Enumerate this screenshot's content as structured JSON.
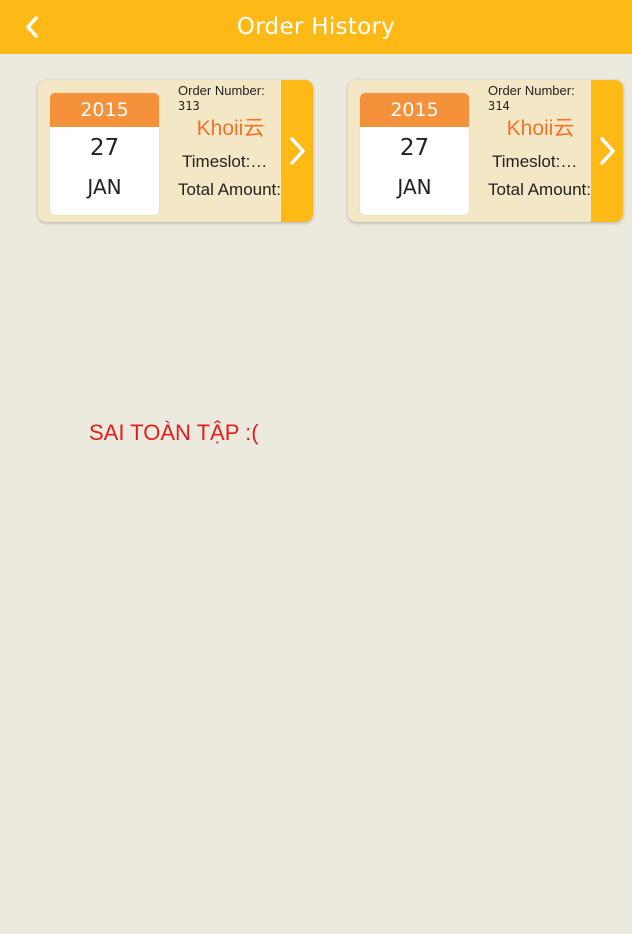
{
  "navbar": {
    "title": "Order History",
    "back_icon": "chevron-left-icon",
    "color": "#FDBA16"
  },
  "orders": [
    {
      "year": "2015",
      "day": "27",
      "month": "JAN",
      "order_number_label": "Order Number:",
      "order_number": "313",
      "store": "Khoii云",
      "timeslot": "Timeslot:…",
      "total": "Total Amount:",
      "arrow_icon": "chevron-right-icon"
    },
    {
      "year": "2015",
      "day": "27",
      "month": "JAN",
      "order_number_label": "Order Number:",
      "order_number": "314",
      "store": "Khoii云",
      "timeslot": "Timeslot:…",
      "total": "Total Amount:",
      "arrow_icon": "chevron-right-icon"
    }
  ],
  "note": {
    "text": "SAI TOÀN TẬP :(",
    "color": "#E0201A"
  }
}
